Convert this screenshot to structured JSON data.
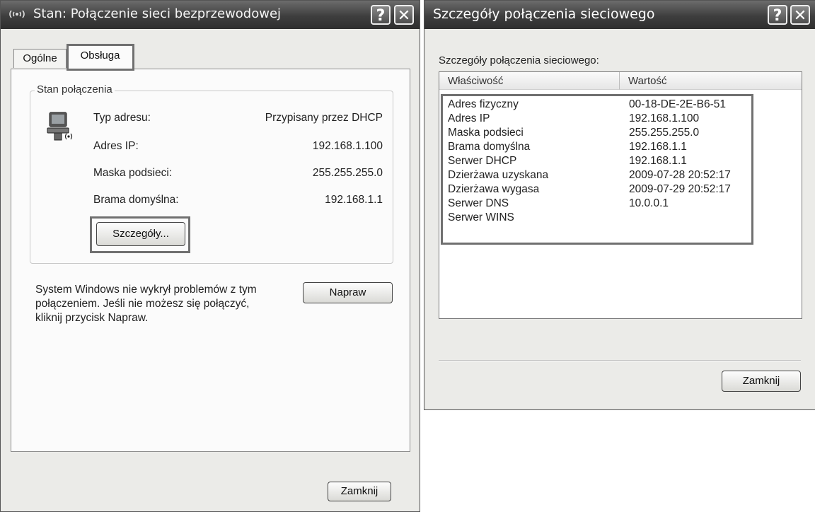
{
  "left_dialog": {
    "title": "Stan: Połączenie sieci bezprzewodowej",
    "title_icon": "wireless-signal-icon",
    "help_button": "?",
    "close_button": "✕",
    "tabs": [
      {
        "label": "Ogólne",
        "selected": false
      },
      {
        "label": "Obsługa",
        "selected": true
      }
    ],
    "group_label": "Stan połączenia",
    "connection_icon": "wireless-network-computer-icon",
    "rows": [
      {
        "label": "Typ adresu:",
        "value": "Przypisany przez DHCP"
      },
      {
        "label": "Adres IP:",
        "value": "192.168.1.100"
      },
      {
        "label": "Maska podsieci:",
        "value": "255.255.255.0"
      },
      {
        "label": "Brama domyślna:",
        "value": "192.168.1.1"
      }
    ],
    "details_button": "Szczegóły...",
    "repair_message_lines": [
      "System Windows nie wykrył problemów z tym",
      "połączeniem. Jeśli nie możesz się połączyć,",
      "kliknij przycisk Napraw."
    ],
    "repair_button": "Napraw",
    "close_label": "Zamknij"
  },
  "right_dialog": {
    "title": "Szczegóły połączenia sieciowego",
    "help_button": "?",
    "close_button": "✕",
    "heading": "Szczegóły połączenia sieciowego:",
    "columns": [
      "Właściwość",
      "Wartość"
    ],
    "rows": [
      {
        "property": "Adres fizyczny",
        "value": "00-18-DE-2E-B6-51"
      },
      {
        "property": "Adres IP",
        "value": "192.168.1.100"
      },
      {
        "property": "Maska podsieci",
        "value": "255.255.255.0"
      },
      {
        "property": "Brama domyślna",
        "value": "192.168.1.1"
      },
      {
        "property": "Serwer DHCP",
        "value": "192.168.1.1"
      },
      {
        "property": "Dzierżawa uzyskana",
        "value": "2009-07-28 20:52:17"
      },
      {
        "property": "Dzierżawa wygasa",
        "value": "2009-07-29 20:52:17"
      },
      {
        "property": "Serwer DNS",
        "value": "10.0.0.1"
      },
      {
        "property": "Serwer WINS",
        "value": ""
      }
    ],
    "close_label": "Zamknij"
  }
}
